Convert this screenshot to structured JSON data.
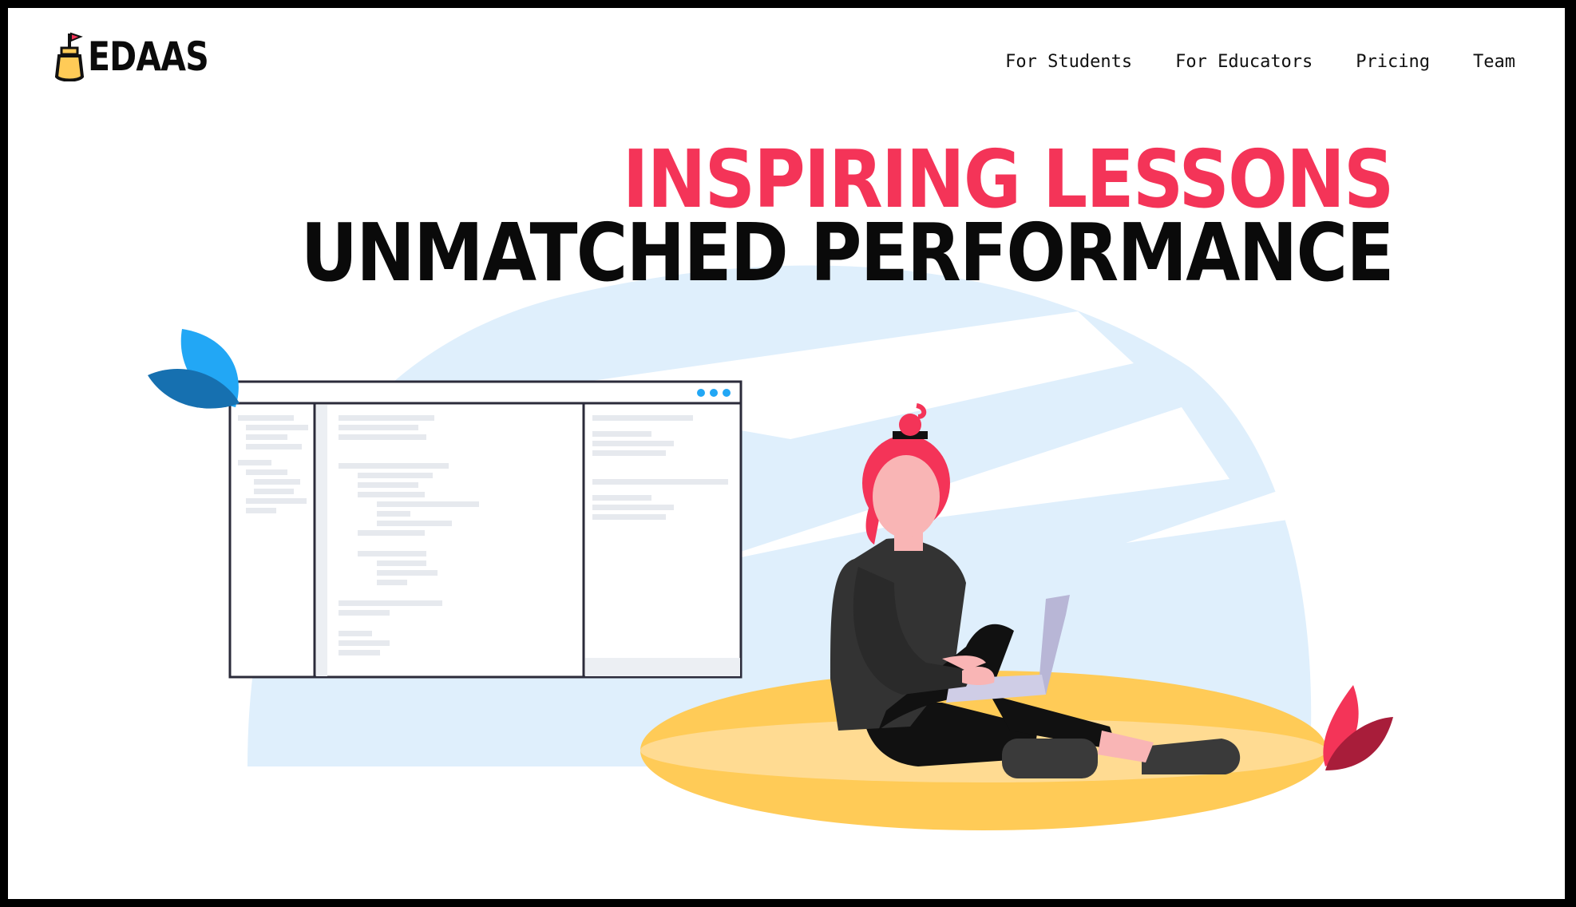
{
  "brand": {
    "name": "EDAAS"
  },
  "nav": {
    "items": [
      {
        "label": "For Students"
      },
      {
        "label": "For Educators"
      },
      {
        "label": "Pricing"
      },
      {
        "label": "Team"
      }
    ]
  },
  "hero": {
    "line1": "INSPIRING LESSONS",
    "line2": "UNMATCHED PERFORMANCE"
  },
  "colors": {
    "accent": "#f43458",
    "text": "#0a0a0a",
    "sky": "#dfeffc",
    "sand": "#ffcb57",
    "blue": "#22a7f5"
  },
  "icons": [
    "logo-sandcastle-icon",
    "window-dots-icon",
    "blue-leaf-icon",
    "red-leaf-icon"
  ]
}
